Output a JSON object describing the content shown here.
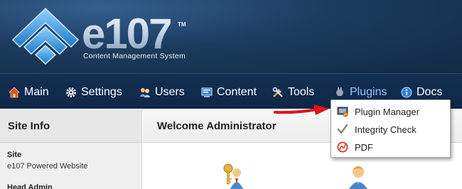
{
  "branding": {
    "logo_text": "e107",
    "trademark": "TM",
    "tagline": "Content Management System"
  },
  "nav": {
    "items": [
      {
        "label": "Main",
        "icon": "house-icon"
      },
      {
        "label": "Settings",
        "icon": "gear-icon"
      },
      {
        "label": "Users",
        "icon": "users-icon"
      },
      {
        "label": "Content",
        "icon": "content-icon"
      },
      {
        "label": "Tools",
        "icon": "tools-icon"
      },
      {
        "label": "Plugins",
        "icon": "plugin-icon",
        "active": true
      },
      {
        "label": "Docs",
        "icon": "info-icon"
      }
    ]
  },
  "plugins_menu": {
    "items": [
      {
        "label": "Plugin Manager",
        "icon": "plugin-manager-icon"
      },
      {
        "label": "Integrity Check",
        "icon": "checkmark-icon"
      },
      {
        "label": "PDF",
        "icon": "pdf-icon"
      }
    ]
  },
  "sidebar": {
    "title": "Site Info",
    "site_label": "Site",
    "site_value": "e107 Powered Website",
    "head_admin_label": "Head Admin"
  },
  "main": {
    "title": "Welcome Administrator"
  },
  "colors": {
    "header_bg": "#1c3b5e",
    "nav_bg": "#133052",
    "active_nav": "#8fc4ff",
    "arrow": "#e0141b"
  }
}
